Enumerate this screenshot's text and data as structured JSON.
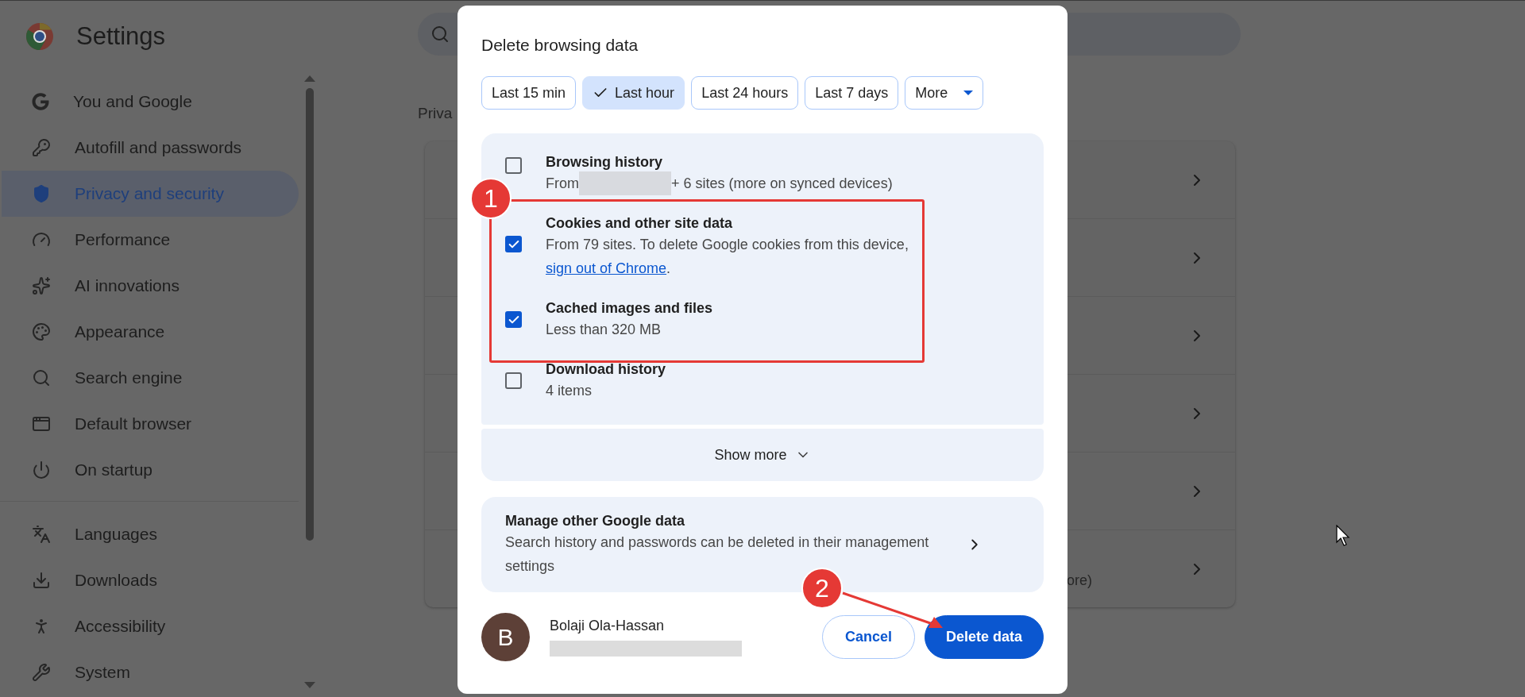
{
  "app": {
    "title": "Settings"
  },
  "sidebar": {
    "sections": [
      {
        "items": [
          {
            "label": "You and Google",
            "selected": false
          },
          {
            "label": "Autofill and passwords",
            "selected": false
          },
          {
            "label": "Privacy and security",
            "selected": true
          },
          {
            "label": "Performance",
            "selected": false
          },
          {
            "label": "AI innovations",
            "selected": false
          },
          {
            "label": "Appearance",
            "selected": false
          },
          {
            "label": "Search engine",
            "selected": false
          },
          {
            "label": "Default browser",
            "selected": false
          },
          {
            "label": "On startup",
            "selected": false
          }
        ]
      },
      {
        "items": [
          {
            "label": "Languages",
            "selected": false
          },
          {
            "label": "Downloads",
            "selected": false
          },
          {
            "label": "Accessibility",
            "selected": false
          },
          {
            "label": "System",
            "selected": false
          }
        ]
      }
    ]
  },
  "main": {
    "heading": "Priva",
    "card": {
      "rows": [
        {
          "chevron": true
        },
        {
          "chevron": true
        },
        {
          "chevron": true
        },
        {
          "chevron": true
        },
        {
          "chevron": true
        },
        {
          "chevron": true,
          "note": "ore)"
        }
      ]
    }
  },
  "dialog": {
    "title": "Delete browsing data",
    "time_ranges": [
      {
        "label": "Last 15 min",
        "selected": false,
        "kind": "chip"
      },
      {
        "label": "Last hour",
        "selected": true,
        "kind": "chip"
      },
      {
        "label": "Last 24 hours",
        "selected": false,
        "kind": "chip"
      },
      {
        "label": "Last 7 days",
        "selected": false,
        "kind": "chip"
      },
      {
        "label": "More",
        "selected": false,
        "kind": "dropdown"
      }
    ],
    "options": [
      {
        "title": "Browsing history",
        "checked": false,
        "description": [
          {
            "kind": "text",
            "text": "From"
          },
          {
            "kind": "redacted"
          },
          {
            "kind": "text",
            "text": "+ 6 sites (more on synced devices)"
          }
        ]
      },
      {
        "title": "Cookies and other site data",
        "checked": true,
        "description": [
          {
            "kind": "text",
            "text": "From 79 sites. To delete Google cookies from this device, "
          },
          {
            "kind": "link",
            "text": "sign out of Chrome"
          },
          {
            "kind": "text",
            "text": "."
          }
        ]
      },
      {
        "title": "Cached images and files",
        "checked": true,
        "description": [
          {
            "kind": "text",
            "text": "Less than 320 MB"
          }
        ]
      },
      {
        "title": "Download history",
        "checked": false,
        "description": [
          {
            "kind": "text",
            "text": "4 items"
          }
        ]
      }
    ],
    "show_more": {
      "label": "Show more"
    },
    "manage": {
      "title": "Manage other Google data",
      "description": "Search history and passwords can be deleted in their management settings"
    },
    "account": {
      "initial": "B",
      "name": "Bolaji Ola-Hassan",
      "email_redacted": true
    },
    "buttons": [
      {
        "label": "Cancel",
        "kind": "secondary"
      },
      {
        "label": "Delete data",
        "kind": "primary"
      }
    ]
  },
  "annotations": [
    {
      "kind": "box-badge",
      "label": "1"
    },
    {
      "kind": "arrow-badge",
      "label": "2"
    }
  ]
}
